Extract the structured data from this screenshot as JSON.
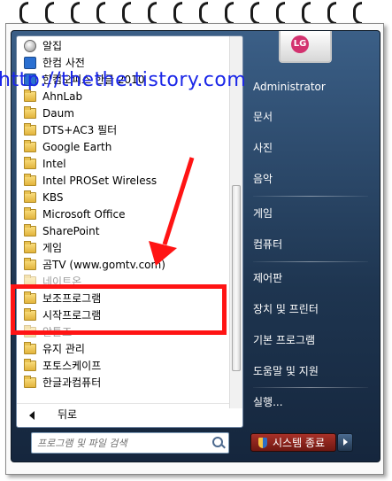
{
  "program_list": [
    {
      "label": "알집",
      "icon": "round-icon",
      "dim": false
    },
    {
      "label": "한컴 사전",
      "icon": "app-icon",
      "dim": false
    },
    {
      "label": "한컴오피스 한글 2010",
      "icon": "app-icon",
      "dim": false
    },
    {
      "label": "AhnLab",
      "icon": "folder-icon",
      "dim": false
    },
    {
      "label": "Daum",
      "icon": "folder-icon",
      "dim": false
    },
    {
      "label": "DTS+AC3 필터",
      "icon": "folder-icon",
      "dim": false
    },
    {
      "label": "Google Earth",
      "icon": "folder-icon",
      "dim": false
    },
    {
      "label": "Intel",
      "icon": "folder-icon",
      "dim": false
    },
    {
      "label": "Intel PROSet Wireless",
      "icon": "folder-icon",
      "dim": false
    },
    {
      "label": "KBS",
      "icon": "folder-icon",
      "dim": false
    },
    {
      "label": "Microsoft Office",
      "icon": "folder-icon",
      "dim": false
    },
    {
      "label": "SharePoint",
      "icon": "folder-icon",
      "dim": false
    },
    {
      "label": "게임",
      "icon": "folder-icon",
      "dim": false
    },
    {
      "label": "곰TV (www.gomtv.com)",
      "icon": "folder-icon",
      "dim": false
    },
    {
      "label": "네이트온",
      "icon": "folder-icon",
      "dim": true
    },
    {
      "label": "보조프로그램",
      "icon": "folder-icon",
      "dim": false
    },
    {
      "label": "시작프로그램",
      "icon": "folder-icon",
      "dim": false
    },
    {
      "label": "알툴즈",
      "icon": "folder-icon",
      "dim": true
    },
    {
      "label": "유지 관리",
      "icon": "folder-icon",
      "dim": false
    },
    {
      "label": "포토스케이프",
      "icon": "folder-icon",
      "dim": false
    },
    {
      "label": "한글과컴퓨터",
      "icon": "folder-icon",
      "dim": false
    }
  ],
  "back_label": "뒤로",
  "search": {
    "placeholder": "프로그램 및 파일 검색"
  },
  "user_tile": {
    "logo": "LG"
  },
  "right_items": {
    "administrator": "Administrator",
    "documents": "문서",
    "pictures": "사진",
    "music": "음악",
    "games": "게임",
    "computer": "컴퓨터",
    "control_panel": "제어판",
    "devices_printers": "장치 및 프린터",
    "default_programs": "기본 프로그램",
    "help_support": "도움말 및 지원",
    "run": "실행..."
  },
  "shutdown_label": "시스템 종료",
  "watermark": "http://thethe.tistory.com",
  "colors": {
    "highlight": "#ff1414",
    "watermark": "#1b27e8",
    "menu_bg": "#1e3550"
  }
}
